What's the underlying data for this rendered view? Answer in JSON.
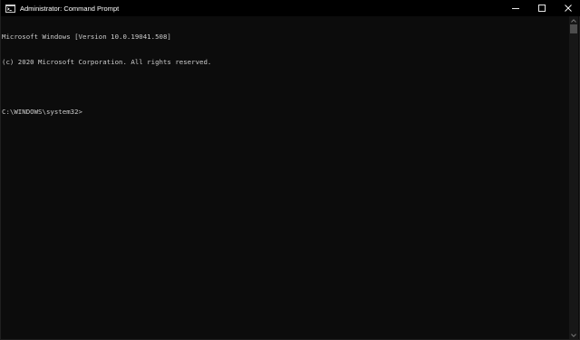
{
  "window": {
    "title": "Administrator: Command Prompt",
    "icon": "cmd-icon"
  },
  "caption_buttons": {
    "minimize": "minimize-icon",
    "maximize": "maximize-icon",
    "close": "close-icon"
  },
  "console": {
    "lines": [
      "Microsoft Windows [Version 10.0.19041.508]",
      "(c) 2020 Microsoft Corporation. All rights reserved.",
      "",
      "C:\\WINDOWS\\system32>"
    ]
  },
  "colors": {
    "background": "#0c0c0c",
    "titlebar": "#000000",
    "text": "#cccccc"
  }
}
